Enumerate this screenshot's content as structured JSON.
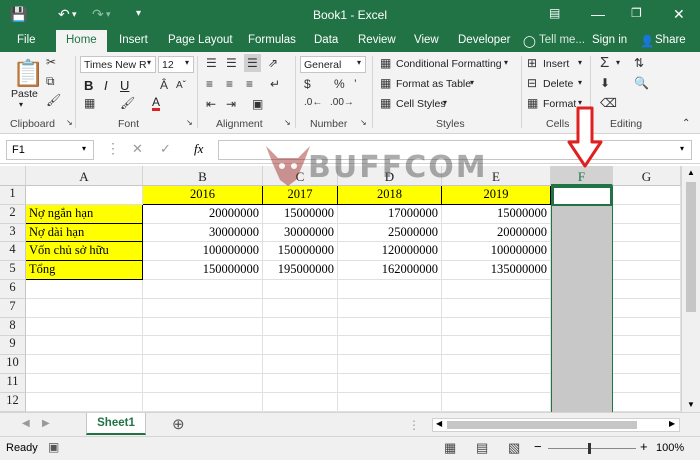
{
  "window": {
    "title": "Book1 - Excel"
  },
  "tabs": [
    "File",
    "Home",
    "Insert",
    "Page Layout",
    "Formulas",
    "Data",
    "Review",
    "View",
    "Developer"
  ],
  "tell_me": "Tell me...",
  "sign_in": "Sign in",
  "share": "Share",
  "ribbon": {
    "paste": "Paste",
    "font_name": "Times New R",
    "font_size": "12",
    "number_format": "General",
    "conditional_formatting": "Conditional Formatting",
    "format_as_table": "Format as Table",
    "cell_styles": "Cell Styles",
    "insert": "Insert",
    "delete": "Delete",
    "format": "Format",
    "groups": [
      "Clipboard",
      "Font",
      "Alignment",
      "Number",
      "Styles",
      "Cells",
      "Editing"
    ]
  },
  "formula_bar": {
    "name_box": "F1",
    "fx": "fx",
    "content": ""
  },
  "columns": [
    "A",
    "B",
    "C",
    "D",
    "E",
    "F",
    "G"
  ],
  "rows": [
    "1",
    "2",
    "3",
    "4",
    "5",
    "6",
    "7",
    "8",
    "9",
    "10",
    "11",
    "12"
  ],
  "headers": [
    "2016",
    "2017",
    "2018",
    "2019"
  ],
  "table": [
    {
      "label": "Nợ ngắn hạn",
      "values": [
        "20000000",
        "15000000",
        "17000000",
        "15000000"
      ]
    },
    {
      "label": "Nợ dài hạn",
      "values": [
        "30000000",
        "30000000",
        "25000000",
        "20000000"
      ]
    },
    {
      "label": "Vốn chủ sở hữu",
      "values": [
        "100000000",
        "150000000",
        "120000000",
        "100000000"
      ]
    },
    {
      "label": "Tổng",
      "values": [
        "150000000",
        "195000000",
        "162000000",
        "135000000"
      ]
    }
  ],
  "watermark": "BUFFCOM",
  "sheet_tab": "Sheet1",
  "status": {
    "left": "Ready",
    "zoom": "100%"
  },
  "colors": {
    "excel_green": "#217346",
    "highlight_yellow": "#ffff00",
    "arrow_red": "#e02020",
    "selected_col": "#c8c8c8"
  }
}
